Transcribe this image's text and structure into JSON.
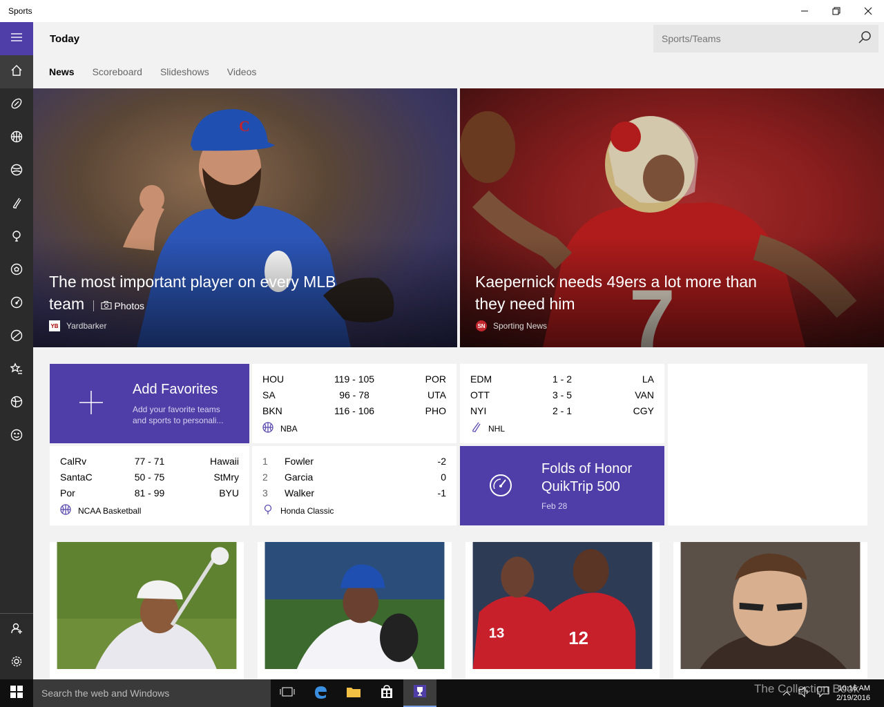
{
  "window": {
    "title": "Sports"
  },
  "header": {
    "title": "Today",
    "search_placeholder": "Sports/Teams",
    "tabs": [
      {
        "label": "News",
        "active": true
      },
      {
        "label": "Scoreboard",
        "active": false
      },
      {
        "label": "Slideshows",
        "active": false
      },
      {
        "label": "Videos",
        "active": false
      }
    ]
  },
  "rail": {
    "items": [
      "menu-icon",
      "home-icon",
      "football-icon",
      "basketball-icon",
      "baseball-icon",
      "hockey-icon",
      "golf-icon",
      "soccer-icon",
      "racing-icon",
      "tennis-icon",
      "favorites-icon",
      "sports-icon",
      "fun-icon"
    ],
    "bottom": [
      "sign-in-icon",
      "settings-icon"
    ]
  },
  "hero": [
    {
      "headline": "The most important player on every MLB team",
      "tag": "Photos",
      "source": "Yardbarker",
      "logo": "YB"
    },
    {
      "headline": "Kaepernick needs 49ers a lot more than they need him",
      "source": "Sporting News",
      "logo": "SN"
    }
  ],
  "favorites": {
    "title": "Add Favorites",
    "subtitle": "Add your favorite teams and sports to personali..."
  },
  "nba": {
    "league": "NBA",
    "games": [
      {
        "home": "HOU",
        "score": "119  -  105",
        "away": "POR"
      },
      {
        "home": "SA",
        "score": "96  -  78",
        "away": "UTA"
      },
      {
        "home": "BKN",
        "score": "116  -  106",
        "away": "PHO"
      }
    ]
  },
  "nhl": {
    "league": "NHL",
    "games": [
      {
        "home": "EDM",
        "score": "1  -  2",
        "away": "LA"
      },
      {
        "home": "OTT",
        "score": "3  -  5",
        "away": "VAN"
      },
      {
        "home": "NYI",
        "score": "2  -  1",
        "away": "CGY"
      }
    ]
  },
  "ncaa": {
    "league": "NCAA Basketball",
    "games": [
      {
        "home": "CalRv",
        "score": "77  -  71",
        "away": "Hawaii"
      },
      {
        "home": "SantaC",
        "score": "50  -  75",
        "away": "StMry"
      },
      {
        "home": "Por",
        "score": "81  -  99",
        "away": "BYU"
      }
    ]
  },
  "golf": {
    "league": "Honda Classic",
    "players": [
      {
        "rank": "1",
        "name": "Fowler",
        "par": "-2"
      },
      {
        "rank": "2",
        "name": "Garcia",
        "par": "0"
      },
      {
        "rank": "3",
        "name": "Walker",
        "par": "-1"
      }
    ]
  },
  "race": {
    "title": "Folds of Honor QuikTrip 500",
    "date": "Feb 28"
  },
  "taskbar": {
    "search_placeholder": "Search the web and Windows",
    "time": "10:16 AM",
    "date": "2/19/2016",
    "watermark": "The Collection Book"
  },
  "colors": {
    "accent": "#4f3ea8",
    "rail": "#2b2b2b"
  }
}
